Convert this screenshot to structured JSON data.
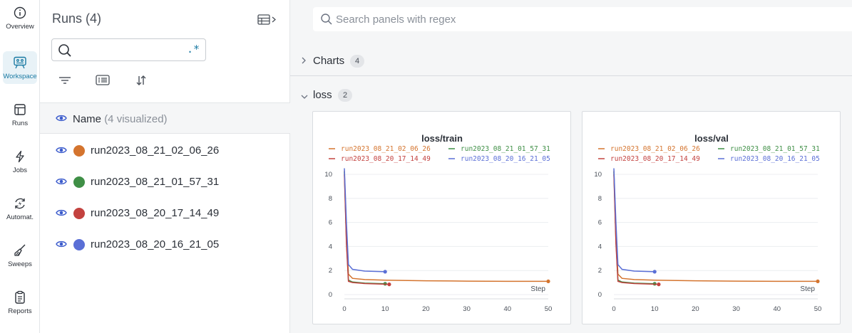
{
  "nav": {
    "items": [
      {
        "label": "Overview",
        "icon": "info-icon"
      },
      {
        "label": "Workspace",
        "icon": "workspace-icon",
        "active": true
      },
      {
        "label": "Runs",
        "icon": "table-icon"
      },
      {
        "label": "Jobs",
        "icon": "lightning-icon"
      },
      {
        "label": "Automat.",
        "icon": "automation-icon"
      },
      {
        "label": "Sweeps",
        "icon": "broom-icon"
      },
      {
        "label": "Reports",
        "icon": "clipboard-icon"
      }
    ],
    "accent": "#1a7aa3"
  },
  "runs": {
    "title": "Runs (4)",
    "search": {
      "value": "",
      "placeholder": "",
      "regex_label": ".*"
    },
    "name_header": {
      "label": "Name",
      "sub": "(4 visualized)"
    },
    "rows": [
      {
        "name": "run2023_08_21_02_06_26",
        "color": "#d4742e"
      },
      {
        "name": "run2023_08_21_01_57_31",
        "color": "#3f8f46"
      },
      {
        "name": "run2023_08_20_17_14_49",
        "color": "#c3423f"
      },
      {
        "name": "run2023_08_20_16_21_05",
        "color": "#5a6fd6"
      }
    ]
  },
  "main": {
    "search": {
      "placeholder": "Search panels with regex"
    },
    "sections": [
      {
        "title": "Charts",
        "count": "4",
        "expanded": false
      },
      {
        "title": "loss",
        "count": "2",
        "expanded": true
      }
    ]
  },
  "chart_data": [
    {
      "type": "line",
      "title": "loss/train",
      "xlabel": "Step",
      "ylabel": "",
      "xlim": [
        0,
        50
      ],
      "ylim": [
        0,
        10
      ],
      "xticks": [
        0,
        10,
        20,
        30,
        40,
        50
      ],
      "yticks": [
        0,
        2,
        4,
        6,
        8,
        10
      ],
      "grid": true,
      "legend": "top",
      "series": [
        {
          "name": "run2023_08_21_02_06_26",
          "color": "#d4742e",
          "x": [
            0,
            0.5,
            1,
            2,
            5,
            10,
            20,
            30,
            40,
            50
          ],
          "y": [
            10.3,
            5.0,
            1.7,
            1.35,
            1.25,
            1.2,
            1.15,
            1.12,
            1.1,
            1.1
          ]
        },
        {
          "name": "run2023_08_21_01_57_31",
          "color": "#3f8f46",
          "x": [
            0,
            0.5,
            1,
            2,
            5,
            10
          ],
          "y": [
            10.2,
            4.5,
            1.2,
            1.05,
            0.95,
            0.9
          ]
        },
        {
          "name": "run2023_08_20_17_14_49",
          "color": "#c3423f",
          "x": [
            0,
            0.5,
            1,
            2,
            5,
            11
          ],
          "y": [
            10.0,
            4.2,
            1.1,
            1.0,
            0.92,
            0.85
          ]
        },
        {
          "name": "run2023_08_20_16_21_05",
          "color": "#5a6fd6",
          "x": [
            0,
            0.5,
            1,
            2,
            5,
            10
          ],
          "y": [
            10.5,
            6.0,
            2.5,
            2.1,
            1.95,
            1.9
          ]
        }
      ]
    },
    {
      "type": "line",
      "title": "loss/val",
      "xlabel": "Step",
      "ylabel": "",
      "xlim": [
        0,
        50
      ],
      "ylim": [
        0,
        10
      ],
      "xticks": [
        0,
        10,
        20,
        30,
        40,
        50
      ],
      "yticks": [
        0,
        2,
        4,
        6,
        8,
        10
      ],
      "grid": true,
      "legend": "top",
      "series": [
        {
          "name": "run2023_08_21_02_06_26",
          "color": "#d4742e",
          "x": [
            0,
            0.5,
            1,
            2,
            5,
            10,
            20,
            30,
            40,
            50
          ],
          "y": [
            10.3,
            5.0,
            1.7,
            1.35,
            1.25,
            1.2,
            1.15,
            1.12,
            1.1,
            1.1
          ]
        },
        {
          "name": "run2023_08_21_01_57_31",
          "color": "#3f8f46",
          "x": [
            0,
            0.5,
            1,
            2,
            5,
            10
          ],
          "y": [
            10.2,
            4.5,
            1.2,
            1.05,
            0.95,
            0.9
          ]
        },
        {
          "name": "run2023_08_20_17_14_49",
          "color": "#c3423f",
          "x": [
            0,
            0.5,
            1,
            2,
            5,
            11
          ],
          "y": [
            10.0,
            4.2,
            1.1,
            1.0,
            0.92,
            0.85
          ]
        },
        {
          "name": "run2023_08_20_16_21_05",
          "color": "#5a6fd6",
          "x": [
            0,
            0.5,
            1,
            2,
            5,
            10
          ],
          "y": [
            10.5,
            6.0,
            2.5,
            2.1,
            1.95,
            1.9
          ]
        }
      ]
    }
  ]
}
